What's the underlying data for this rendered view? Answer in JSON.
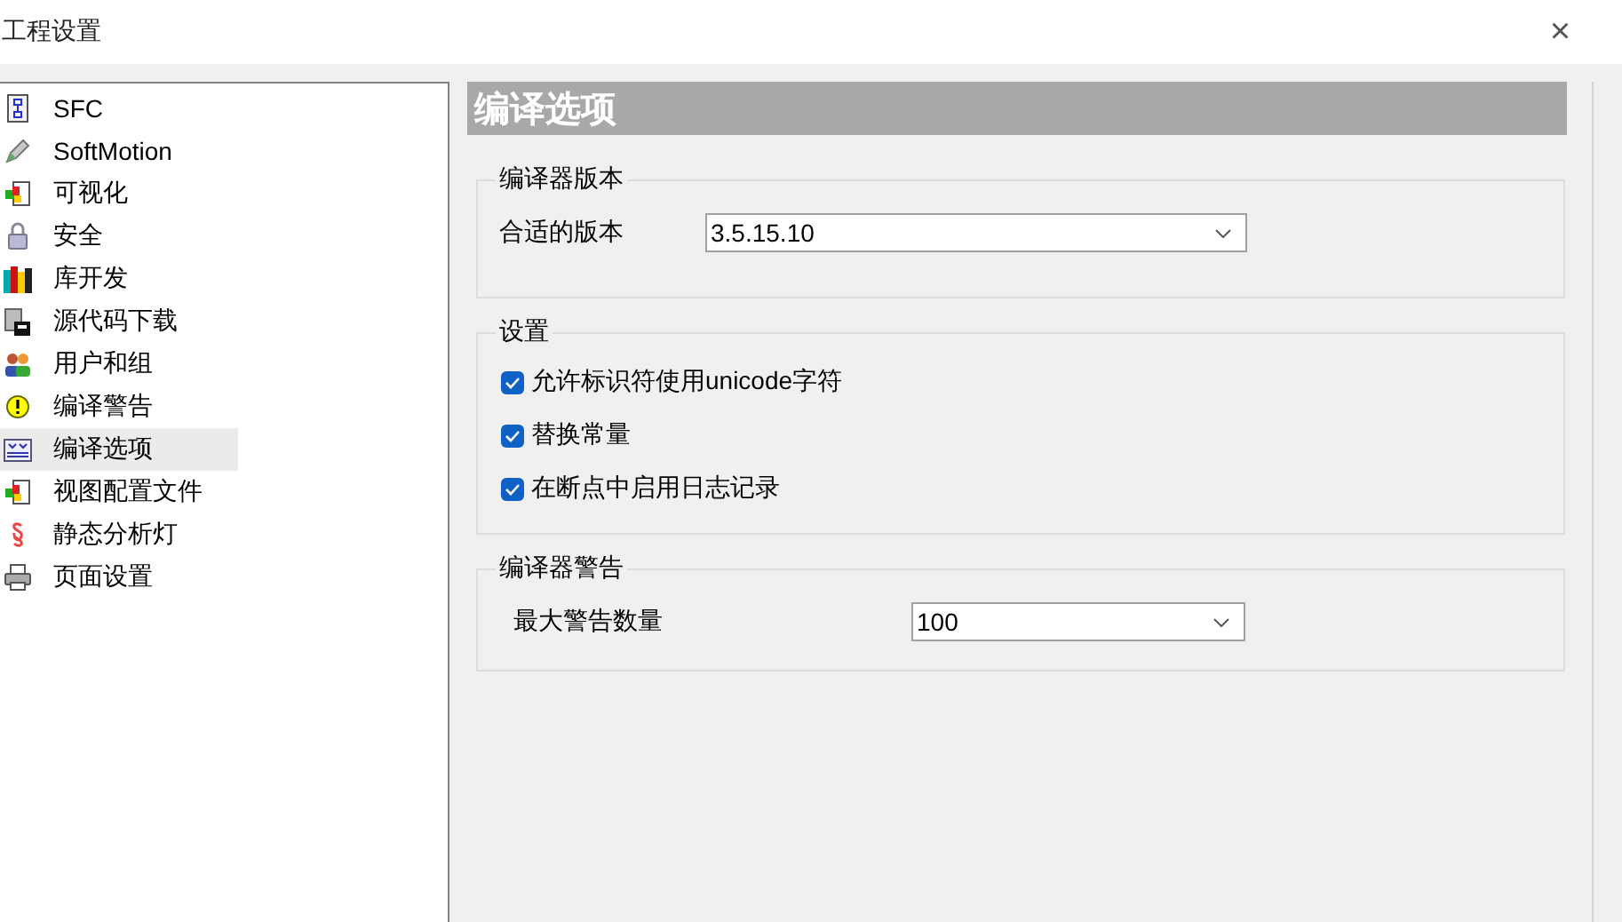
{
  "window": {
    "title": "工程设置",
    "close": "×"
  },
  "sidebar": {
    "items": [
      {
        "label": "SFC",
        "selected": false
      },
      {
        "label": "SoftMotion",
        "selected": false
      },
      {
        "label": "可视化",
        "selected": false
      },
      {
        "label": "安全",
        "selected": false
      },
      {
        "label": "库开发",
        "selected": false
      },
      {
        "label": "源代码下载",
        "selected": false
      },
      {
        "label": "用户和组",
        "selected": false
      },
      {
        "label": "编译警告",
        "selected": false
      },
      {
        "label": "编译选项",
        "selected": true
      },
      {
        "label": "视图配置文件",
        "selected": false
      },
      {
        "label": "静态分析灯",
        "selected": false
      },
      {
        "label": "页面设置",
        "selected": false
      }
    ]
  },
  "panel": {
    "header": "编译选项",
    "groups": [
      {
        "title": "编译器版本",
        "rows": [
          {
            "kind": "dropdown",
            "label": "合适的版本",
            "value": "3.5.15.10"
          }
        ]
      },
      {
        "title": "设置",
        "rows": [
          {
            "kind": "checkbox",
            "label": "允许标识符使用unicode字符",
            "checked": true
          },
          {
            "kind": "checkbox",
            "label": "替换常量",
            "checked": true
          },
          {
            "kind": "checkbox",
            "label": "在断点中启用日志记录",
            "checked": true
          }
        ]
      },
      {
        "title": "编译器警告",
        "rows": [
          {
            "kind": "dropdown",
            "label": "最大警告数量",
            "value": "100"
          }
        ]
      }
    ]
  }
}
